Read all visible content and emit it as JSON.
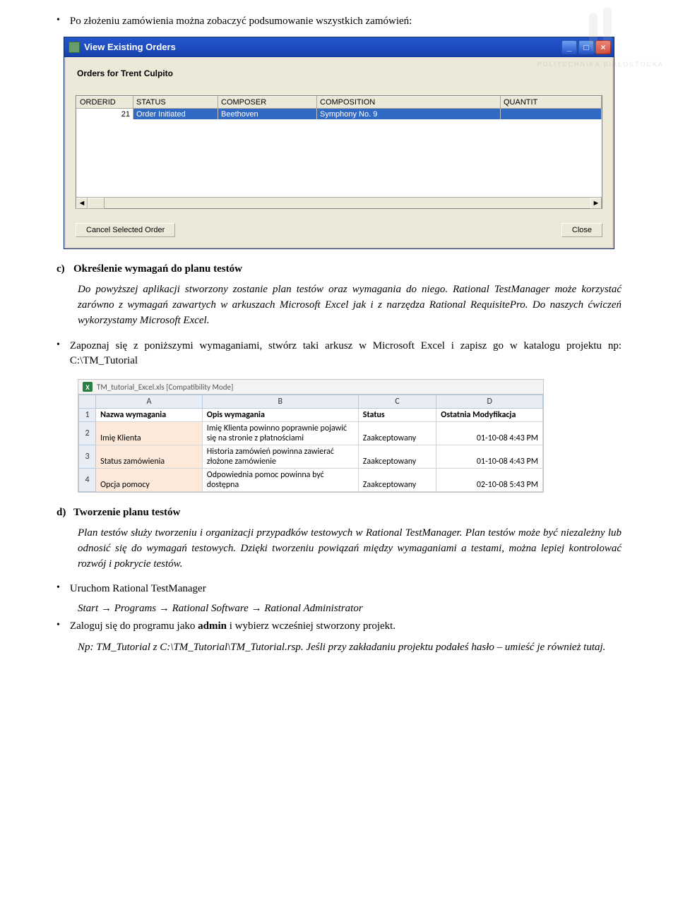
{
  "watermark": {
    "line1": "POLITECHNIKA",
    "line2": "BIAŁOSTOCKA"
  },
  "bullet1": "Po złożeniu zamówienia można zobaczyć podsumowanie wszystkich zamówień:",
  "xp": {
    "title": "View Existing Orders",
    "min": "_",
    "max": "□",
    "close": "×",
    "orders_for": "Orders for Trent Culpito",
    "cols": [
      "ORDERID",
      "STATUS",
      "COMPOSER",
      "COMPOSITION",
      "QUANTIT"
    ],
    "row": {
      "id": "21",
      "status": "Order Initiated",
      "composer": "Beethoven",
      "composition": "Symphony No. 9",
      "qty": ""
    },
    "scroll_left": "◄",
    "scroll_right": "►",
    "btn_cancel": "Cancel Selected Order",
    "btn_close": "Close"
  },
  "section_c": {
    "letter": "c)",
    "title": "Określenie wymagań do planu testów",
    "p1a": "Do powyższej aplikacji stworzony zostanie plan testów oraz wymagania do niego. Rational TestManager może korzystać zarówno z wymagań zawartych w arkuszach Microsoft Excel jak i z narzędza Rational RequisitePro. Do naszych ćwiczeń wykorzystamy Microsoft Excel.",
    "bullet2": "Zapoznaj się z poniższymi wymaganiami, stwórz taki arkusz w Microsoft Excel i zapisz go w katalogu projektu np: C:\\TM_Tutorial"
  },
  "excel": {
    "filename": "TM_tutorial_Excel.xls  [Compatibility Mode]",
    "col_letters": [
      "A",
      "B",
      "C",
      "D"
    ],
    "rows": [
      {
        "n": "1",
        "a": "Nazwa wymagania",
        "b": "Opis wymagania",
        "c": "Status",
        "d": "Ostatnia Modyfikacja"
      },
      {
        "n": "2",
        "a": "Imię Klienta",
        "b": "Imię Klienta powinno poprawnie pojawić się na stronie z płatnościami",
        "c": "Zaakceptowany",
        "d": "01-10-08 4:43 PM"
      },
      {
        "n": "3",
        "a": "Status zamówienia",
        "b": "Historia zamówień powinna zawierać złożone zamówienie",
        "c": "Zaakceptowany",
        "d": "01-10-08 4:43 PM"
      },
      {
        "n": "4",
        "a": "Opcja pomocy",
        "b": "Odpowiednia pomoc powinna być dostępna",
        "c": "Zaakceptowany",
        "d": "02-10-08 5:43 PM"
      }
    ]
  },
  "section_d": {
    "letter": "d)",
    "title": "Tworzenie planu testów",
    "p1": "Plan testów służy tworzeniu i organizacji przypadków testowych w Rational TestManager. Plan testów może być niezależny lub odnosić się do wymagań testowych. Dzięki tworzeniu powiązań między wymaganiami a testami, można lepiej kontrolować rozwój i pokrycie testów.",
    "b1": "Uruchom Rational TestManager",
    "b1_sub_a": "Start ",
    "b1_sub_b": " Programs ",
    "b1_sub_c": " Rational Software    ",
    "b1_sub_d": " Rational Administrator",
    "arrow": "→",
    "b2_a": "Zaloguj się do programu jako ",
    "b2_admin": "admin",
    "b2_b": " i wybierz wcześniej stworzony projekt.",
    "b2_sub": "Np: TM_Tutorial z C:\\TM_Tutorial\\TM_Tutorial.rsp. Jeśli przy zakładaniu projektu podałeś hasło – umieść je również tutaj."
  }
}
